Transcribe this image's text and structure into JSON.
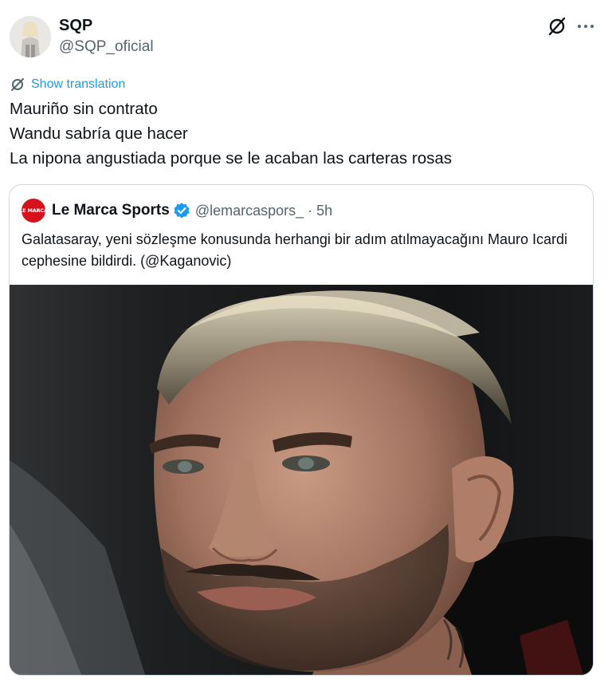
{
  "author": {
    "name": "SQP",
    "handle": "@SQP_oficial"
  },
  "icons": {
    "grok": "grok-icon",
    "more": "more-icon",
    "translate": "translate-icon",
    "verified": "verified-badge-icon"
  },
  "translation": {
    "label": "Show translation"
  },
  "tweet": {
    "lines": [
      "Mauriño sin contrato",
      "Wandu sabría que hacer",
      "La nipona angustiada porque se le acaban las carteras rosas"
    ]
  },
  "quote": {
    "avatar_text": "LE MARCA",
    "name": "Le Marca Sports",
    "handle": "@lemarcaspors_",
    "separator": "·",
    "time": "5h",
    "text": "Galatasaray, yeni sözleşme konusunda herhangi bir adım atılmayacağını Mauro Icardi cephesine bildirdi. (@Kaganovic)"
  },
  "colors": {
    "link_blue": "#1d9bf0",
    "secondary_text": "#536471",
    "primary_text": "#0f1419",
    "border": "#cfd9de",
    "brand_red": "#d5121b"
  }
}
